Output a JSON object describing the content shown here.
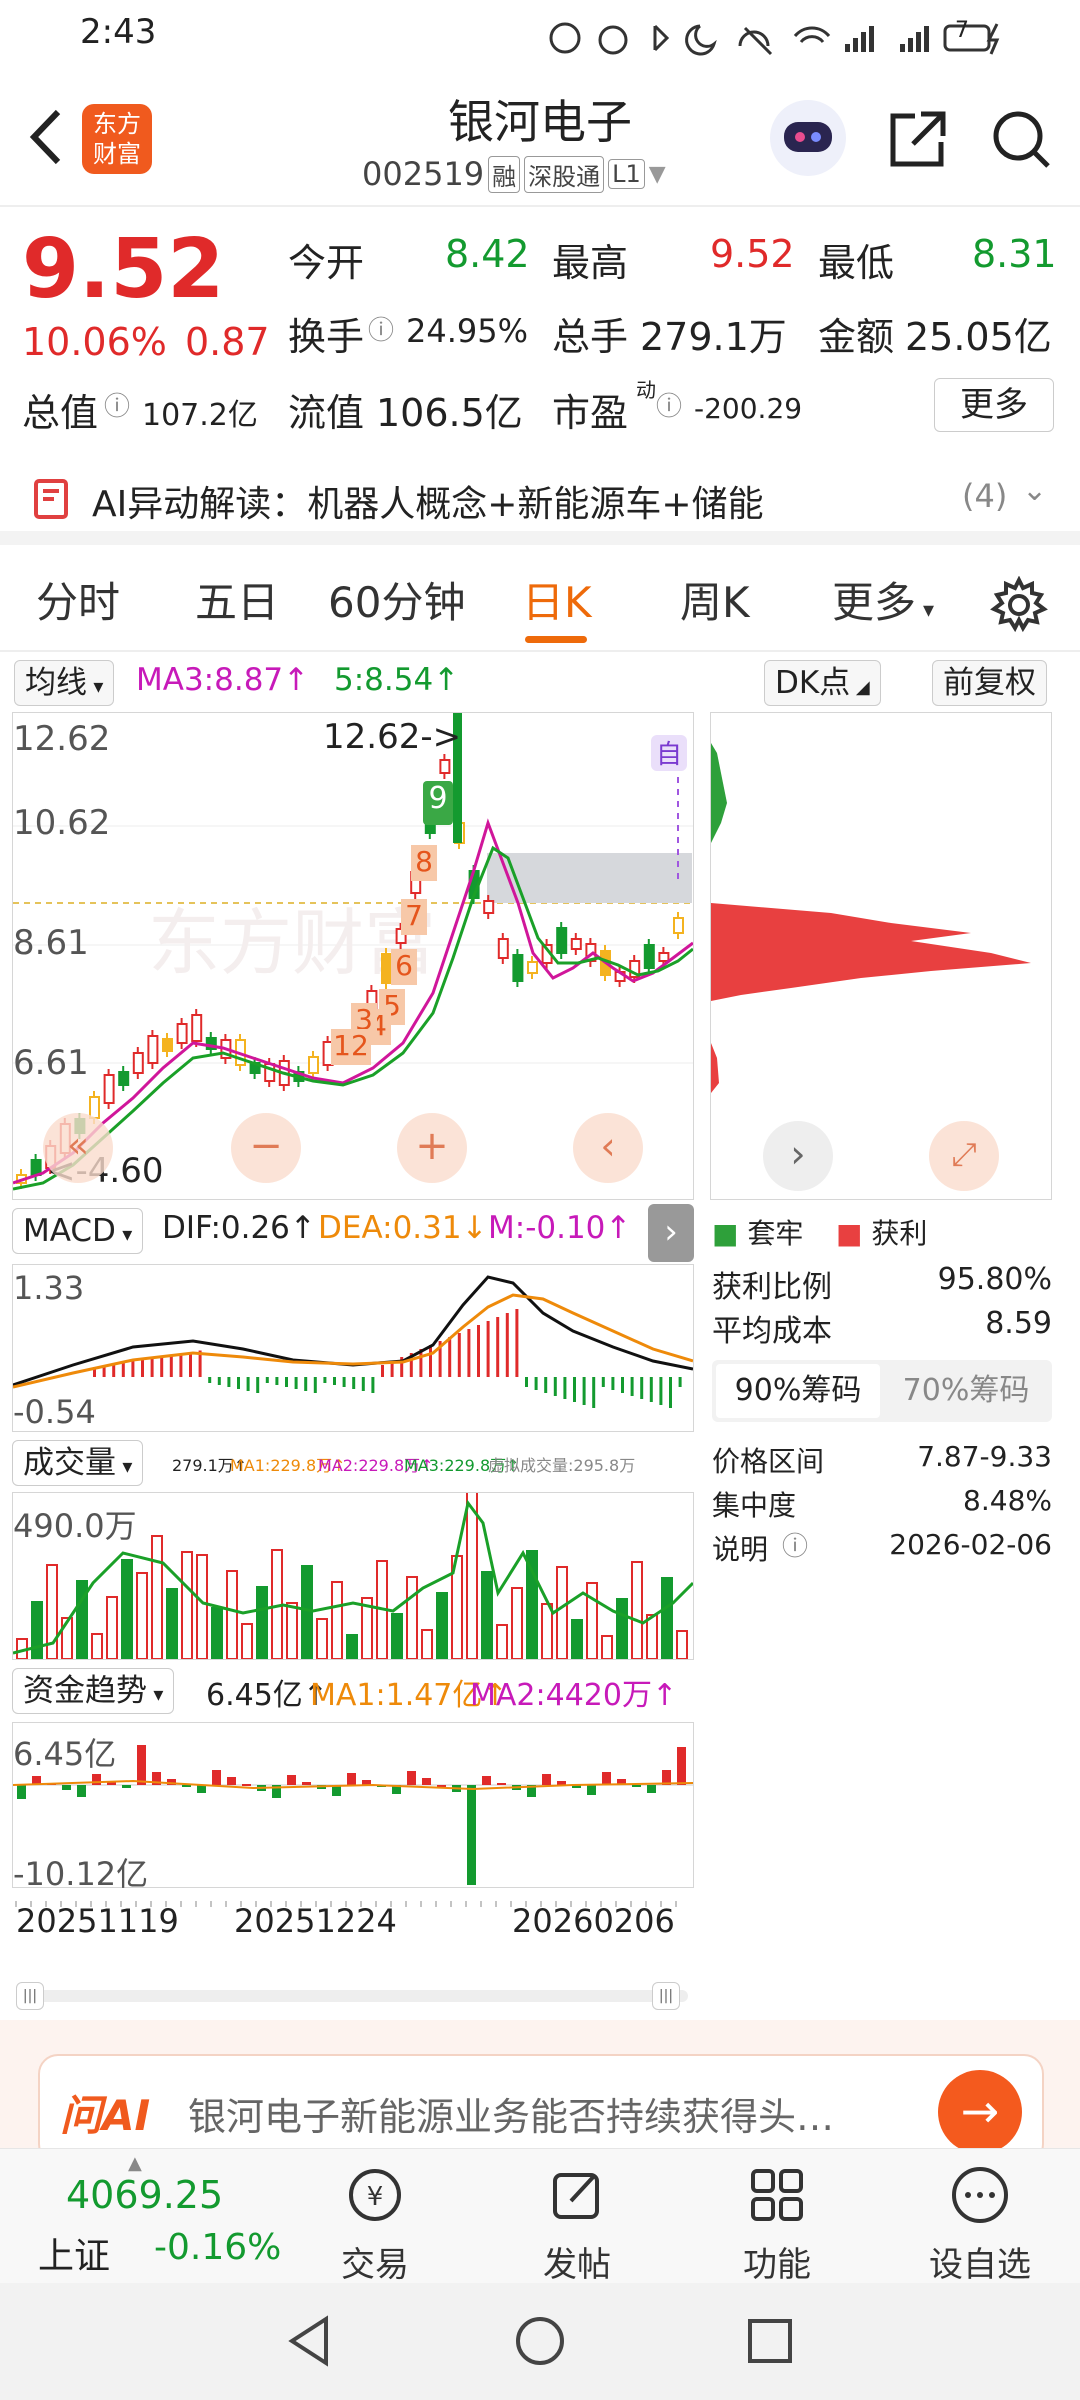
{
  "status": {
    "time": "2:43",
    "battery": "7"
  },
  "header": {
    "title": "银河电子",
    "code": "002519",
    "tags": [
      "融",
      "深股通",
      "L1"
    ],
    "logo_line1": "东方",
    "logo_line2": "财富"
  },
  "quote": {
    "price": "9.52",
    "change_pct": "10.06%",
    "change": "0.87",
    "open_label": "今开",
    "open": "8.42",
    "high_label": "最高",
    "high": "9.52",
    "low_label": "最低",
    "low": "8.31",
    "turnover_label": "换手",
    "turnover": "24.95%",
    "volume_label": "总手",
    "volume": "279.1万",
    "amount_label": "金额",
    "amount": "25.05亿",
    "mktcap_label": "总值",
    "mktcap": "107.2亿",
    "float_label": "流值",
    "float": "106.5亿",
    "pe_label": "市盈",
    "pe_sup": "动",
    "pe": "-200.29",
    "more": "更多"
  },
  "ai_bar": {
    "text": "AI异动解读：机器人概念+新能源车+储能",
    "count": "(4)"
  },
  "tabs": [
    "分时",
    "五日",
    "60分钟",
    "日K",
    "周K",
    "更多"
  ],
  "kline": {
    "indicator": "均线",
    "ma3": "MA3:8.87↑",
    "ma5": "5:8.54↑",
    "dk": "DK点",
    "fq": "前复权",
    "y_labels": [
      "12.62",
      "10.62",
      "8.61",
      "6.61"
    ],
    "min_label": "<-4.60",
    "max_label": "12.62->",
    "self_tag": "自",
    "signals": [
      "12",
      "3",
      "4",
      "5",
      "6",
      "7",
      "8",
      "9"
    ]
  },
  "chips_panel": {
    "legend_trapped": "套牢",
    "legend_profit": "获利",
    "profit_ratio_label": "获利比例",
    "profit_ratio": "95.80%",
    "avg_cost_label": "平均成本",
    "avg_cost": "8.59",
    "tab_90": "90%筹码",
    "tab_70": "70%筹码",
    "range_label": "价格区间",
    "range": "7.87-9.33",
    "concentration_label": "集中度",
    "concentration": "8.48%",
    "note_label": "说明",
    "note_date": "2026-02-06"
  },
  "macd": {
    "label": "MACD",
    "dif": "DIF:0.26↑",
    "dea": "DEA:0.31↓",
    "m": "M:-0.10↑",
    "top": "1.33",
    "bottom": "-0.54"
  },
  "volume": {
    "label": "成交量",
    "v": "279.1万↑",
    "ma1": "MA1:229.8万↑",
    "ma2": "MA2:229.8万↑",
    "ma3": "MA3:229.8万↑",
    "virtual": "虚拟成交量:295.8万",
    "top": "490.0万"
  },
  "fund": {
    "label": "资金趋势",
    "value": "6.45亿↑",
    "ma1": "MA1:1.47亿↑",
    "ma2": "MA2:4420万↑",
    "top": "6.45亿",
    "bottom": "-10.12亿"
  },
  "dates": [
    "20251119",
    "20251224",
    "20260206"
  ],
  "ai_ask": {
    "logo": "问AI",
    "text": "银河电子新能源业务能否持续获得头…"
  },
  "bottom_nav": {
    "index_value": "4069.25",
    "index_name": "上证",
    "index_change": "-0.16%",
    "items": [
      "交易",
      "发帖",
      "功能",
      "设自选"
    ]
  },
  "colors": {
    "up": "#e02a2a",
    "down": "#139a2f",
    "accent": "#ee6a0a"
  }
}
